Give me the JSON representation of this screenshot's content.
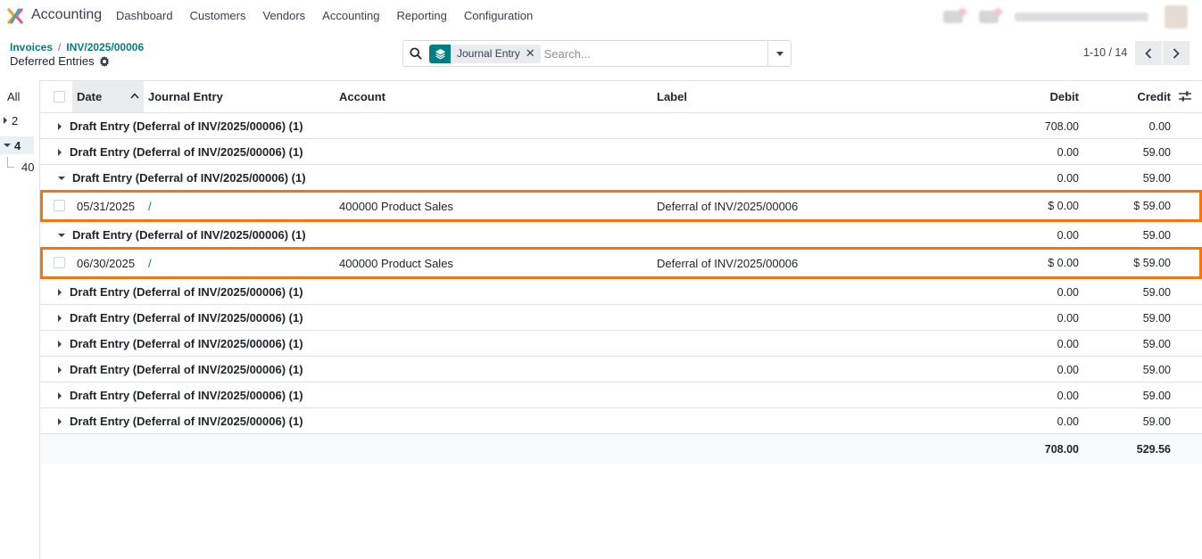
{
  "app": {
    "name": "Accounting",
    "menu": [
      "Dashboard",
      "Customers",
      "Vendors",
      "Accounting",
      "Reporting",
      "Configuration"
    ]
  },
  "breadcrumb": {
    "parent": "Invoices",
    "current": "INV/2025/00006",
    "view_title": "Deferred Entries"
  },
  "search": {
    "facet_label": "Journal Entry",
    "placeholder": "Search..."
  },
  "pager": {
    "value": "1-10 / 14"
  },
  "side_panel": {
    "all": "All",
    "items": [
      {
        "label": "2",
        "expanded": false
      },
      {
        "label": "4",
        "expanded": true
      }
    ],
    "sub_item": "40"
  },
  "table": {
    "headers": {
      "date": "Date",
      "journal_entry": "Journal Entry",
      "account": "Account",
      "label": "Label",
      "debit": "Debit",
      "credit": "Credit"
    },
    "rows": [
      {
        "type": "group",
        "label": "Draft Entry (Deferral of INV/2025/00006) (1)",
        "debit": "708.00",
        "credit": "0.00",
        "expanded": false
      },
      {
        "type": "group",
        "label": "Draft Entry (Deferral of INV/2025/00006) (1)",
        "debit": "0.00",
        "credit": "59.00",
        "expanded": false
      },
      {
        "type": "group",
        "label": "Draft Entry (Deferral of INV/2025/00006) (1)",
        "debit": "0.00",
        "credit": "59.00",
        "expanded": true
      },
      {
        "type": "record",
        "date": "05/31/2025",
        "journal_entry": "/",
        "account": "400000 Product Sales",
        "label": "Deferral of INV/2025/00006",
        "debit": "$ 0.00",
        "credit": "$ 59.00"
      },
      {
        "type": "group",
        "label": "Draft Entry (Deferral of INV/2025/00006) (1)",
        "debit": "0.00",
        "credit": "59.00",
        "expanded": true
      },
      {
        "type": "record",
        "date": "06/30/2025",
        "journal_entry": "/",
        "account": "400000 Product Sales",
        "label": "Deferral of INV/2025/00006",
        "debit": "$ 0.00",
        "credit": "$ 59.00"
      },
      {
        "type": "group",
        "label": "Draft Entry (Deferral of INV/2025/00006) (1)",
        "debit": "0.00",
        "credit": "59.00",
        "expanded": false
      },
      {
        "type": "group",
        "label": "Draft Entry (Deferral of INV/2025/00006) (1)",
        "debit": "0.00",
        "credit": "59.00",
        "expanded": false
      },
      {
        "type": "group",
        "label": "Draft Entry (Deferral of INV/2025/00006) (1)",
        "debit": "0.00",
        "credit": "59.00",
        "expanded": false
      },
      {
        "type": "group",
        "label": "Draft Entry (Deferral of INV/2025/00006) (1)",
        "debit": "0.00",
        "credit": "59.00",
        "expanded": false
      },
      {
        "type": "group",
        "label": "Draft Entry (Deferral of INV/2025/00006) (1)",
        "debit": "0.00",
        "credit": "59.00",
        "expanded": false
      },
      {
        "type": "group",
        "label": "Draft Entry (Deferral of INV/2025/00006) (1)",
        "debit": "0.00",
        "credit": "59.00",
        "expanded": false
      }
    ],
    "totals": {
      "debit": "708.00",
      "credit": "529.56"
    }
  },
  "colors": {
    "brand": "#017e84",
    "highlight": "#f5740f"
  }
}
